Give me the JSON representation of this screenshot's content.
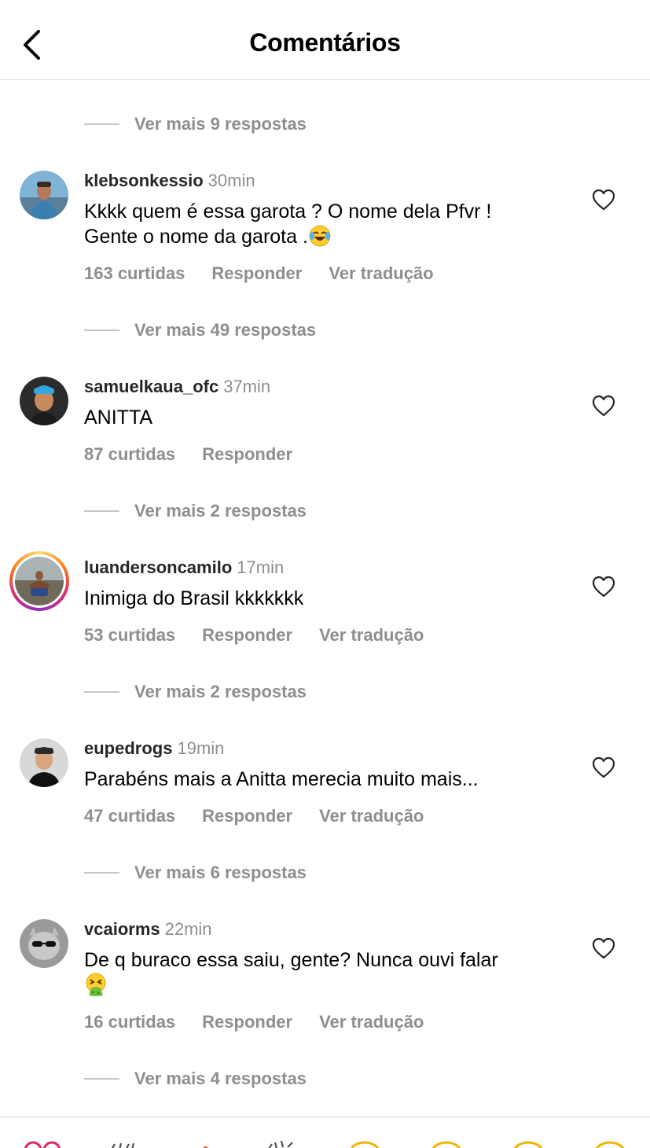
{
  "header": {
    "title": "Comentários"
  },
  "view_more": [
    "Ver mais 9 respostas",
    "Ver mais 49 respostas",
    "Ver mais 2 respostas",
    "Ver mais 2 respostas",
    "Ver mais 6 respostas",
    "Ver mais 4 respostas"
  ],
  "comments": [
    {
      "username": "klebsonkessio",
      "time": "30min",
      "text_line1": "Kkkk quem é essa garota ? O nome dela Pfvr !",
      "text_line2": "Gente o nome da garota .",
      "emoji": "😂",
      "likes": "163 curtidas",
      "reply": "Responder",
      "translate": "Ver tradução"
    },
    {
      "username": "samuelkaua_ofc",
      "time": "37min",
      "text_line1": "ANITTA",
      "likes": "87 curtidas",
      "reply": "Responder"
    },
    {
      "username": "luandersoncamilo",
      "time": "17min",
      "text_line1": "Inimiga do Brasil kkkkkkk",
      "likes": "53 curtidas",
      "reply": "Responder",
      "translate": "Ver tradução"
    },
    {
      "username": "eupedrogs",
      "time": "19min",
      "text_line1": "Parabéns mais a Anitta merecia muito mais...",
      "likes": "47 curtidas",
      "reply": "Responder",
      "translate": "Ver tradução"
    },
    {
      "username": "vcaiorms",
      "time": "22min",
      "text_line1": "De q buraco essa saiu, gente? Nunca ouvi falar",
      "emoji": "🤮",
      "likes": "16 curtidas",
      "reply": "Responder",
      "translate": "Ver tradução"
    }
  ],
  "colors": {
    "text": "#262626",
    "muted": "#8e8e8e",
    "divider": "#dbdbdb",
    "line": "#c7c7c7"
  },
  "icons": [
    "back-chevron-icon",
    "heart-outline-icon",
    "laughing-tears-emoji",
    "vomiting-face-emoji"
  ]
}
